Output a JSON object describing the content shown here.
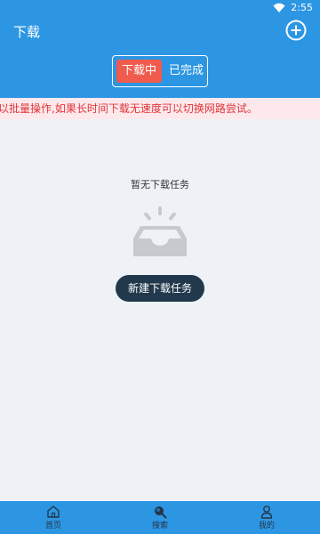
{
  "status_bar": {
    "time": "2:55"
  },
  "app_bar": {
    "title": "下载"
  },
  "segments": [
    {
      "label": "下载中",
      "active": true
    },
    {
      "label": "已完成",
      "active": false
    }
  ],
  "notice": {
    "text": "以批量操作,如果长时间下载无速度可以切换网路尝试。"
  },
  "empty_state": {
    "title": "暂无下载任务",
    "button_label": "新建下载任务"
  },
  "tab_bar": [
    {
      "label": "首页",
      "icon": "home-icon"
    },
    {
      "label": "搜索",
      "icon": "search-icon"
    },
    {
      "label": "我的",
      "icon": "user-icon"
    }
  ],
  "colors": {
    "primary": "#2d96e3",
    "active_segment": "#f05b4e",
    "notice_bg": "#fde9ec",
    "notice_text": "#e0353a",
    "button": "#22384c"
  }
}
